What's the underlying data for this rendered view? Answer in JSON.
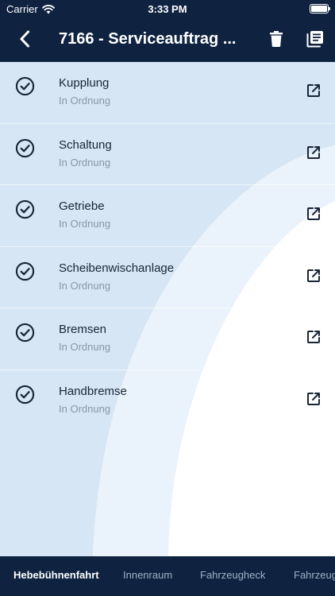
{
  "status_bar": {
    "carrier": "Carrier",
    "time": "3:33 PM",
    "battery_level": 1.0
  },
  "nav": {
    "title": "7166 - Serviceauftrag ...",
    "back_icon": "chevron-left-icon",
    "trash_icon": "trash-icon",
    "document_icon": "document-stack-icon"
  },
  "items": [
    {
      "title": "Kupplung",
      "status": "In Ordnung"
    },
    {
      "title": "Schaltung",
      "status": "In Ordnung"
    },
    {
      "title": "Getriebe",
      "status": "In Ordnung"
    },
    {
      "title": "Scheibenwischanlage",
      "status": "In Ordnung"
    },
    {
      "title": "Bremsen",
      "status": "In Ordnung"
    },
    {
      "title": "Handbremse",
      "status": "In Ordnung"
    }
  ],
  "tabs": [
    {
      "label": "Hebebühnenfahrt",
      "active": true
    },
    {
      "label": "Innenraum",
      "active": false
    },
    {
      "label": "Fahrzeugheck",
      "active": false
    },
    {
      "label": "Fahrzeugfront",
      "active": false
    }
  ],
  "colors": {
    "header_bg": "#0f2340",
    "list_bg": "#d6e6f4",
    "arc_light": "#eaf3fb",
    "text_primary": "#1a2536",
    "text_secondary": "#8a96a6"
  }
}
